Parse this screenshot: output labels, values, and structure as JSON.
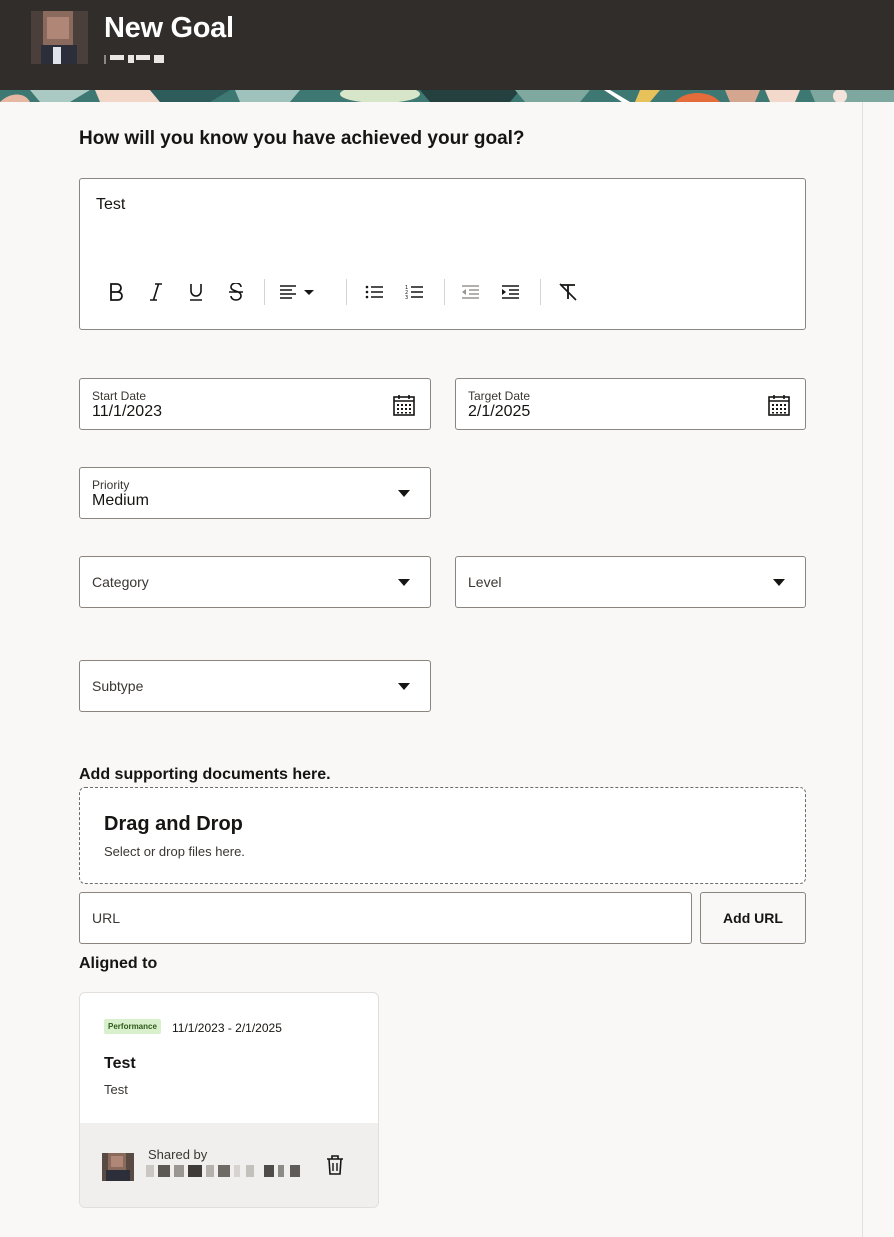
{
  "header": {
    "title": "New Goal"
  },
  "measure": {
    "question": "How will you know you have achieved your goal?",
    "text": "Test",
    "toolbar": [
      "bold-icon",
      "italic-icon",
      "underline-icon",
      "strikethrough-icon",
      "align-left-icon",
      "bulleted-list-icon",
      "numbered-list-icon",
      "outdent-icon",
      "indent-icon",
      "clear-formatting-icon"
    ]
  },
  "start_date": {
    "label": "Start Date",
    "value": "11/1/2023"
  },
  "target_date": {
    "label": "Target Date",
    "value": "2/1/2025"
  },
  "priority": {
    "label": "Priority",
    "value": "Medium"
  },
  "category": {
    "placeholder": "Category"
  },
  "level": {
    "placeholder": "Level"
  },
  "subtype": {
    "placeholder": "Subtype"
  },
  "attachments": {
    "heading": "Add supporting documents here.",
    "dropzone_title": "Drag and Drop",
    "dropzone_subtitle": "Select or drop files here.",
    "url_placeholder": "URL",
    "add_url_label": "Add URL"
  },
  "aligned": {
    "heading": "Aligned to",
    "card": {
      "badge": "Performance",
      "badge_color": "#d9f0cc",
      "dates": "11/1/2023 - 2/1/2025",
      "title": "Test",
      "description": "Test",
      "shared_by_label": "Shared by"
    }
  },
  "colors": {
    "header_bg": "#312d2a",
    "page_bg": "#f9f8f6",
    "border": "#8b8580"
  }
}
